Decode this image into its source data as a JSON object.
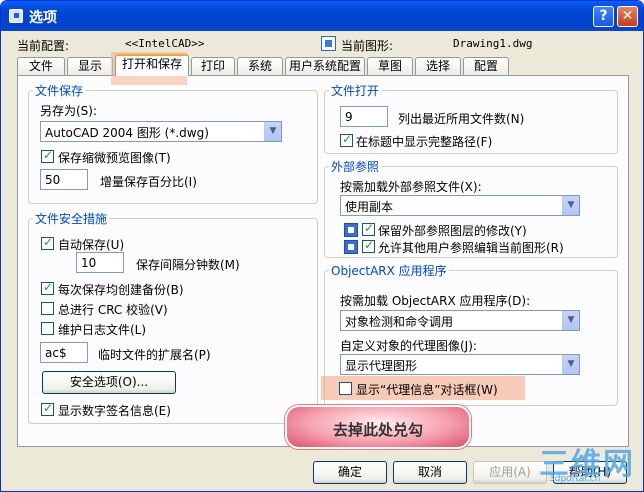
{
  "window": {
    "title": "选项",
    "help_symbol": "?",
    "close_symbol": "✕"
  },
  "header": {
    "current_profile_label": "当前配置:",
    "current_profile_value": "<<IntelCAD>>",
    "current_drawing_label": "当前图形:",
    "current_drawing_value": "Drawing1.dwg"
  },
  "tabs": [
    "文件",
    "显示",
    "打开和保存",
    "打印",
    "系统",
    "用户系统配置",
    "草图",
    "选择",
    "配置"
  ],
  "active_tab": "打开和保存",
  "file_save": {
    "legend": "文件保存",
    "save_as_label": "另存为(S):",
    "save_as_value": "AutoCAD 2004 图形 (*.dwg)",
    "save_thumbnail_label": "保存缩微预览图像(T)",
    "save_thumbnail_checked": true,
    "incremental_value": "50",
    "incremental_label": "增量保存百分比(I)"
  },
  "file_safety": {
    "legend": "文件安全措施",
    "autosave_label": "自动保存(U)",
    "autosave_checked": true,
    "minutes_value": "10",
    "minutes_label": "保存间隔分钟数(M)",
    "backup_label": "每次保存均创建备份(B)",
    "backup_checked": true,
    "crc_label": "总进行 CRC 校验(V)",
    "crc_checked": false,
    "log_label": "维护日志文件(L)",
    "log_checked": false,
    "temp_ext_value": "ac$",
    "temp_ext_label": "临时文件的扩展名(P)",
    "security_button": "安全选项(O)...",
    "digital_sig_label": "显示数字签名信息(E)",
    "digital_sig_checked": true
  },
  "file_open": {
    "legend": "文件打开",
    "recent_count_value": "9",
    "recent_count_label": "列出最近所用文件数(N)",
    "full_path_label": "在标题中显示完整路径(F)",
    "full_path_checked": true
  },
  "xref": {
    "legend": "外部参照",
    "demand_load_label": "按需加载外部参照文件(X):",
    "demand_load_value": "使用副本",
    "retain_layers_label": "保留外部参照图层的修改(Y)",
    "retain_layers_checked": true,
    "allow_edit_label": "允许其他用户参照编辑当前图形(R)",
    "allow_edit_checked": true
  },
  "objectarx": {
    "legend": "ObjectARX 应用程序",
    "demand_load_label": "按需加载 ObjectARX 应用程序(D):",
    "demand_load_value": "对象检测和命令调用",
    "proxy_images_label": "自定义对象的代理图像(J):",
    "proxy_images_value": "显示代理图形",
    "proxy_info_label": "显示“代理信息”对话框(W)",
    "proxy_info_checked": false
  },
  "callout_text": "去掉此处兑勾",
  "buttons": {
    "ok": "确定",
    "cancel": "取消",
    "apply": "应用(A)",
    "help": "帮助(H)"
  },
  "watermark": {
    "brand": "三维网",
    "url": "3dportal.cn"
  }
}
